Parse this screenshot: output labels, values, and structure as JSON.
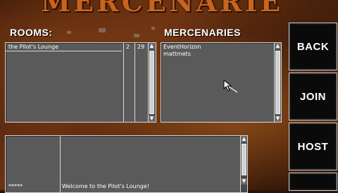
{
  "title": "MERCENARIES",
  "rooms": {
    "heading": "ROOMS:",
    "rows": [
      {
        "name": "the Pilot's Lounge",
        "count": "2",
        "max": "29"
      }
    ]
  },
  "mercenaries": {
    "heading": "MERCENARIES",
    "names": [
      "EventHorizon",
      "mattmets"
    ]
  },
  "chat": {
    "sender": "*****",
    "message": "Welcome to the Pilot's Lounge!"
  },
  "buttons": {
    "back": "BACK",
    "join": "JOIN",
    "host": "HOST"
  },
  "icons": {
    "scroll_up": "▲",
    "scroll_down": "▼",
    "pointer": "arrow-cursor-icon"
  }
}
